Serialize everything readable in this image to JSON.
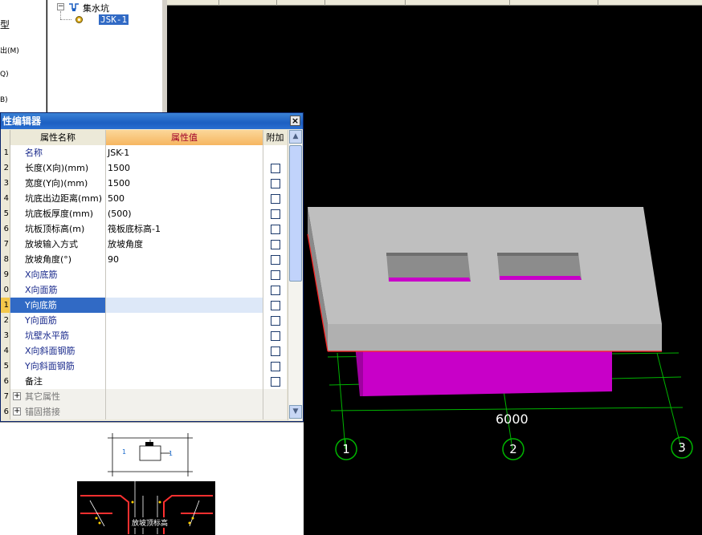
{
  "left_nav": {
    "items": [
      "型",
      "出(M)",
      "Q)",
      "B)"
    ]
  },
  "tree": {
    "root_label": "集水坑",
    "child_label": "JSK-1"
  },
  "property_editor": {
    "title": "性编辑器",
    "close_label": "×",
    "headers": {
      "name": "属性名称",
      "value": "属性值",
      "add": "附加"
    },
    "rows": [
      {
        "num": "1",
        "name": "名称",
        "value": "JSK-1",
        "blue": true,
        "checkbox": false
      },
      {
        "num": "2",
        "name": "长度(X向)(mm)",
        "value": "1500",
        "blue": false,
        "checkbox": true
      },
      {
        "num": "3",
        "name": "宽度(Y向)(mm)",
        "value": "1500",
        "blue": false,
        "checkbox": true
      },
      {
        "num": "4",
        "name": "坑底出边距离(mm)",
        "value": "500",
        "blue": false,
        "checkbox": true
      },
      {
        "num": "5",
        "name": "坑底板厚度(mm)",
        "value": "(500)",
        "blue": false,
        "checkbox": true
      },
      {
        "num": "6",
        "name": "坑板顶标高(m)",
        "value": "筏板底标高-1",
        "blue": false,
        "checkbox": true
      },
      {
        "num": "7",
        "name": "放坡输入方式",
        "value": "放坡角度",
        "blue": false,
        "checkbox": true
      },
      {
        "num": "8",
        "name": "放坡角度(°)",
        "value": "90",
        "blue": false,
        "checkbox": true
      },
      {
        "num": "9",
        "name": "X向底筋",
        "value": "",
        "blue": true,
        "checkbox": true
      },
      {
        "num": "0",
        "name": "X向面筋",
        "value": "",
        "blue": true,
        "checkbox": true
      },
      {
        "num": "1",
        "name": "Y向底筋",
        "value": "",
        "blue": true,
        "checkbox": true,
        "selected": true
      },
      {
        "num": "2",
        "name": "Y向面筋",
        "value": "",
        "blue": true,
        "checkbox": true
      },
      {
        "num": "3",
        "name": "坑壁水平筋",
        "value": "",
        "blue": true,
        "checkbox": true
      },
      {
        "num": "4",
        "name": "X向斜面钢筋",
        "value": "",
        "blue": true,
        "checkbox": true
      },
      {
        "num": "5",
        "name": "Y向斜面钢筋",
        "value": "",
        "blue": true,
        "checkbox": true
      },
      {
        "num": "6",
        "name": "备注",
        "value": "",
        "blue": false,
        "checkbox": true
      }
    ],
    "groups": [
      {
        "num": "7",
        "name": "其它属性",
        "expander": "+"
      },
      {
        "num": "6",
        "name": "锚固搭接",
        "expander": "+"
      }
    ]
  },
  "preview": {
    "caption": "放坡顶标高",
    "label_1": "1"
  },
  "scene": {
    "dimension": "6000",
    "axes": [
      "1",
      "2",
      "3"
    ],
    "colors": {
      "slab_top": "#bebebe",
      "slab_side": "#a8a8a8",
      "pit": "#c800c8",
      "grid": "#00b400",
      "edge": "#ff2020"
    }
  }
}
